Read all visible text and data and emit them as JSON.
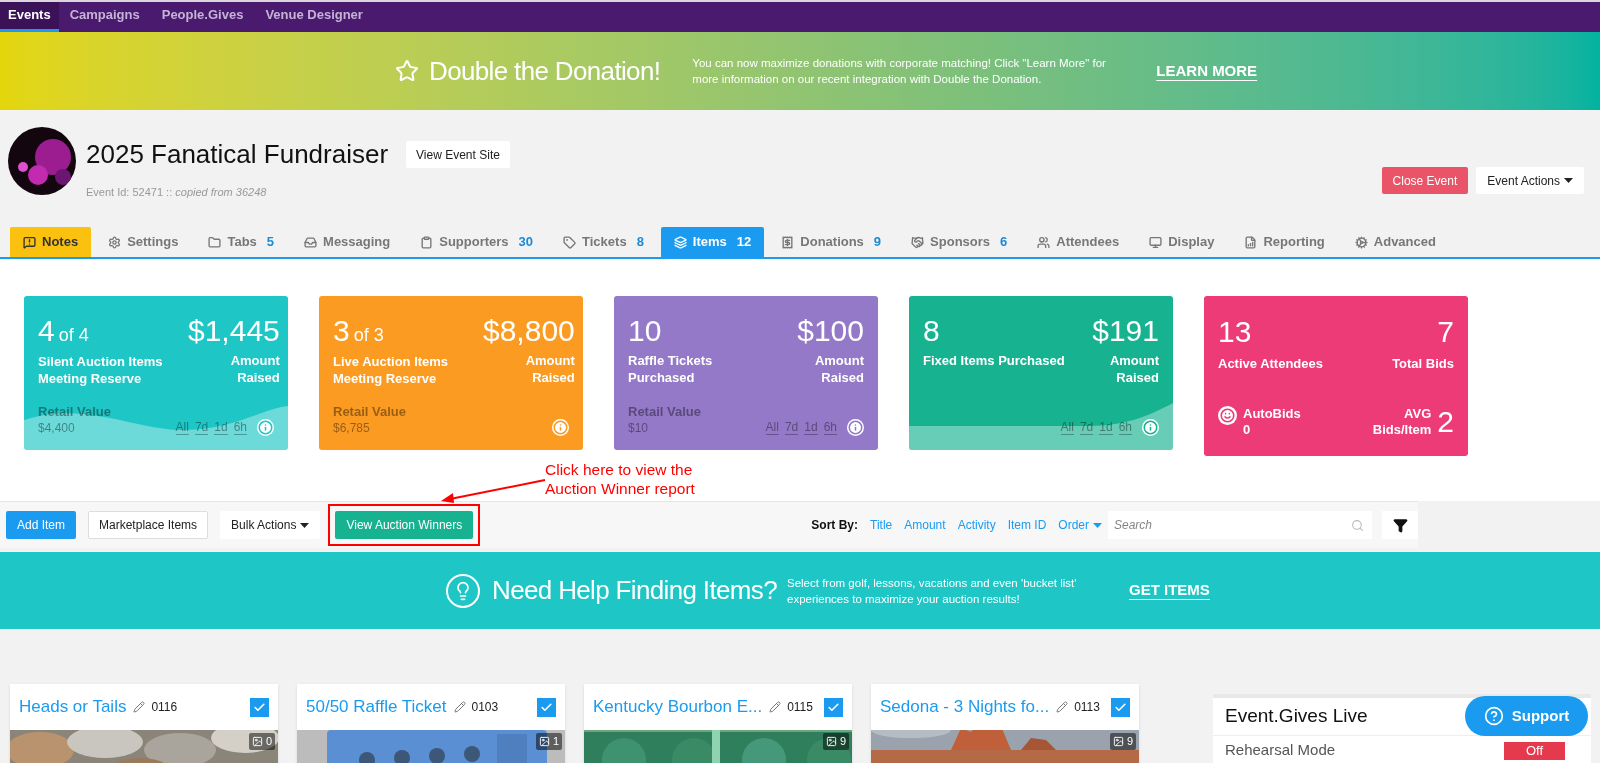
{
  "top_nav": [
    {
      "label": "Events",
      "selected": true
    },
    {
      "label": "Campaigns",
      "selected": false
    },
    {
      "label": "People.Gives",
      "selected": false
    },
    {
      "label": "Venue Designer",
      "selected": false
    }
  ],
  "promo_banner": {
    "title": "Double the Donation!",
    "text": "You can now maximize donations with corporate matching! Click \"Learn More\" for more information on our recent integration with Double the Donation.",
    "link": "LEARN MORE"
  },
  "event": {
    "title": "2025 Fanatical Fundraiser",
    "view_site": "View Event Site",
    "id_text": "Event Id: 52471 ::",
    "copied": "copied from 36248",
    "close": "Close Event",
    "actions": "Event Actions"
  },
  "tabs": [
    {
      "kind": "notes",
      "label": "Notes",
      "selected": false
    },
    {
      "kind": "tab",
      "label": "Settings",
      "selected": false
    },
    {
      "kind": "tab",
      "label": "Tabs",
      "count": "5",
      "selected": false
    },
    {
      "kind": "tab",
      "label": "Messaging",
      "selected": false
    },
    {
      "kind": "tab",
      "label": "Supporters",
      "count": "30",
      "selected": false
    },
    {
      "kind": "tab",
      "label": "Tickets",
      "count": "8",
      "selected": false
    },
    {
      "kind": "tab",
      "label": "Items",
      "count": "12",
      "selected": true
    },
    {
      "kind": "tab",
      "label": "Donations",
      "count": "9",
      "selected": false
    },
    {
      "kind": "tab",
      "label": "Sponsors",
      "count": "6",
      "selected": false
    },
    {
      "kind": "tab",
      "label": "Attendees",
      "selected": false
    },
    {
      "kind": "tab",
      "label": "Display",
      "selected": false
    },
    {
      "kind": "tab",
      "label": "Reporting",
      "selected": false
    },
    {
      "kind": "tab",
      "label": "Advanced",
      "selected": false
    }
  ],
  "stat_cards": [
    {
      "kind": "sales",
      "color": "#1fc6c6",
      "count": "4",
      "of": "of 4",
      "label": "Silent Auction Items Meeting Reserve",
      "amount": "$1,445",
      "amount_label": "Amount Raised",
      "retail_label": "Retail Value",
      "retail": "$4,400",
      "filters": [
        "All",
        "7d",
        "1d",
        "6h"
      ],
      "wave": true
    },
    {
      "kind": "sales",
      "color": "#fb9b21",
      "count": "3",
      "of": "of 3",
      "label": "Live Auction Items Meeting Reserve",
      "amount": "$8,800",
      "amount_label": "Amount Raised",
      "retail_label": "Retail Value",
      "retail": "$6,785",
      "wave": false
    },
    {
      "kind": "sales",
      "color": "#9479c8",
      "count": "10",
      "label": "Raffle Tickets Purchased",
      "amount": "$100",
      "amount_label": "Amount Raised",
      "retail_label": "Retail Value",
      "retail": "$10",
      "filters": [
        "All",
        "7d",
        "1d",
        "6h"
      ],
      "wave": false
    },
    {
      "kind": "sales",
      "color": "#17b290",
      "count": "8",
      "label": "Fixed Items Purchased",
      "amount": "$191",
      "amount_label": "Amount Raised",
      "filters": [
        "All",
        "7d",
        "1d",
        "6h"
      ],
      "wave": true
    },
    {
      "kind": "attendees",
      "color": "#ec3b76",
      "count": "13",
      "label": "Active Attendees",
      "total": "7",
      "total_label": "Total Bids",
      "autobids_label": "AutoBids",
      "autobids": "0",
      "avg_label": "AVG Bids/Item",
      "avg": "2"
    }
  ],
  "annotation": {
    "text": "Click here to view the Auction Winner report"
  },
  "toolbar": {
    "add": "Add Item",
    "marketplace": "Marketplace Items",
    "bulk": "Bulk Actions",
    "winners": "View Auction Winners",
    "sort_label": "Sort By:",
    "sort_links": [
      "Title",
      "Amount",
      "Activity",
      "Item ID"
    ],
    "order": "Order",
    "search_placeholder": "Search"
  },
  "help_banner": {
    "title": "Need Help Finding Items?",
    "text": "Select from golf, lessons, vacations and even 'bucket list' experiences to maximize your auction results!",
    "link": "GET ITEMS"
  },
  "items": [
    {
      "title": "Heads or Tails",
      "id": "0116",
      "checked": true,
      "images": "0"
    },
    {
      "title": "50/50 Raffle Ticket",
      "id": "0103",
      "checked": true,
      "images": "1"
    },
    {
      "title": "Kentucky Bourbon E...",
      "id": "0115",
      "checked": true,
      "images": "9"
    },
    {
      "title": "Sedona - 3 Nights fo...",
      "id": "0113",
      "checked": true,
      "images": "9"
    }
  ],
  "live_panel": {
    "title": "Event.Gives Live",
    "row_label": "Rehearsal Mode",
    "row_value": "Off"
  },
  "support": "Support"
}
